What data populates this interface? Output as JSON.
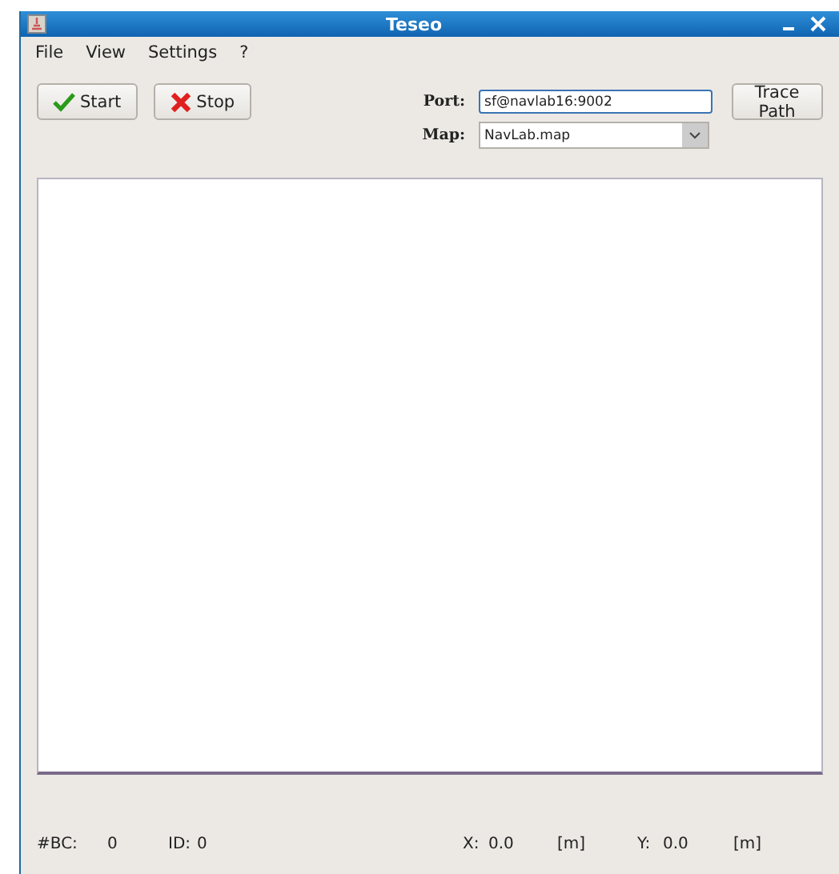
{
  "window": {
    "title": "Teseo"
  },
  "menu": [
    "File",
    "View",
    "Settings",
    "?"
  ],
  "toolbar": {
    "start": "Start",
    "stop": "Stop",
    "port_label": "Port:",
    "port_value": "sf@navlab16:9002",
    "map_label": "Map:",
    "map_value": "NavLab.map",
    "trace": "Trace Path"
  },
  "status_bar": {
    "bc_label": "#BC:",
    "bc_value": "0",
    "id_label": "ID:",
    "id_value": "0",
    "x_label": "X:",
    "x_value": "0.0",
    "x_unit": "[m]",
    "y_label": "Y:",
    "y_value": "0.0",
    "y_unit": "[m]"
  }
}
